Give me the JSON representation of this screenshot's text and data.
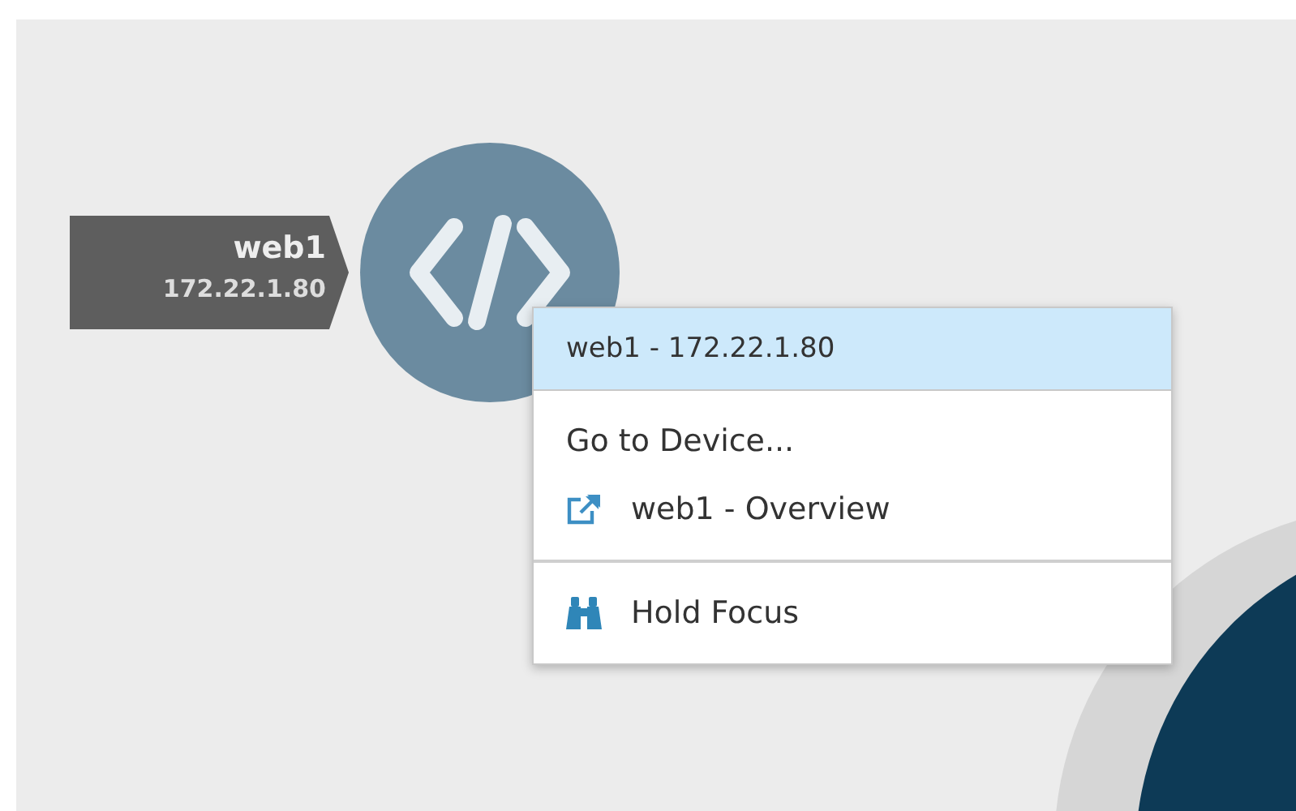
{
  "node": {
    "name": "web1",
    "address": "172.22.1.80"
  },
  "context_menu": {
    "header": "web1 - 172.22.1.80",
    "sections": [
      [
        {
          "kind": "plain",
          "label": "Go to Device..."
        },
        {
          "kind": "link",
          "label": "web1 - Overview"
        }
      ],
      [
        {
          "kind": "focus",
          "label": "Hold Focus"
        }
      ]
    ]
  }
}
